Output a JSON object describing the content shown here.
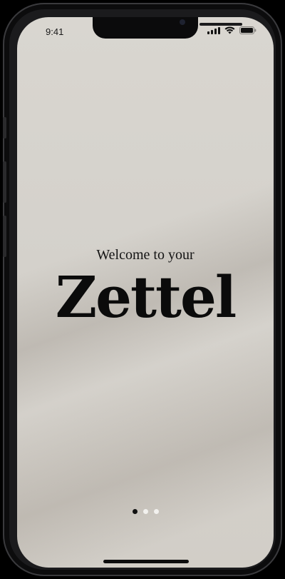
{
  "status_bar": {
    "time": "9:41"
  },
  "onboarding": {
    "welcome_text": "Welcome to your",
    "brand_name": "Zettel",
    "page_count": 3,
    "active_page": 1
  },
  "colors": {
    "background": "#d6d3cd",
    "text": "#0b0b0b",
    "dot_active": "#111111",
    "dot_inactive": "#f2f1ee"
  }
}
